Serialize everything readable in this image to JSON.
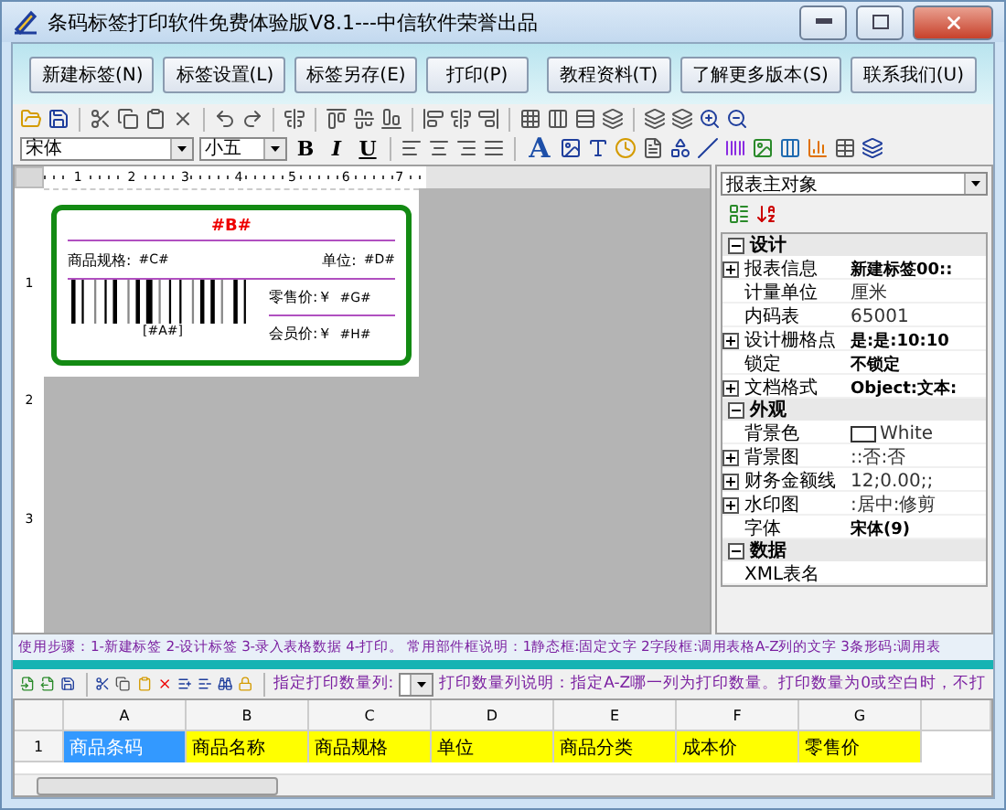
{
  "window": {
    "title": "条码标签打印软件免费体验版V8.1---中信软件荣誉出品"
  },
  "buttons_left": [
    "新建标签(N)",
    "标签设置(L)",
    "标签另存(E)",
    "打印(P)"
  ],
  "buttons_right": [
    "教程资料(T)",
    "了解更多版本(S)",
    "联系我们(U)"
  ],
  "format_bar": {
    "font": "宋体",
    "size": "小五",
    "style_buttons": [
      {
        "label": "B",
        "kind": "bold"
      },
      {
        "label": "I",
        "kind": "italic"
      },
      {
        "label": "U",
        "kind": "underline"
      }
    ],
    "text_tool": "A"
  },
  "rulers": {
    "horizontal": [
      "1",
      "2",
      "3",
      "4",
      "5",
      "6",
      "7"
    ],
    "vertical": [
      "1",
      "2",
      "3"
    ]
  },
  "label": {
    "title": "#B#",
    "spec_label": "商品规格:",
    "spec_value": "#C#",
    "unit_label": "单位:",
    "unit_value": "#D#",
    "barcode_text": "[#A#]",
    "retail_label": "零售价:￥",
    "retail_value": "#G#",
    "member_label": "会员价:￥",
    "member_value": "#H#"
  },
  "properties": {
    "object": "报表主对象",
    "sections": [
      {
        "title": "设计",
        "expanded": true,
        "rows": [
          {
            "name": "报表信息",
            "value": "新建标签00::",
            "expandable": true,
            "bold": true
          },
          {
            "name": "计量单位",
            "value": "厘米",
            "expandable": false,
            "bold": false
          },
          {
            "name": "内码表",
            "value": "65001",
            "expandable": false,
            "bold": false
          },
          {
            "name": "设计栅格点",
            "value": "是:是:10:10",
            "expandable": true,
            "bold": true
          },
          {
            "name": "锁定",
            "value": "不锁定",
            "expandable": false,
            "bold": true
          },
          {
            "name": "文档格式",
            "value": "Object:文本:",
            "expandable": true,
            "bold": true
          }
        ]
      },
      {
        "title": "外观",
        "expanded": true,
        "rows": [
          {
            "name": "背景色",
            "value": "White",
            "expandable": false,
            "bold": false,
            "color": "#ffffff"
          },
          {
            "name": "背景图",
            "value": "::否:否",
            "expandable": true,
            "bold": false
          },
          {
            "name": "财务金额线",
            "value": "12;0.00;;",
            "expandable": true,
            "bold": false
          },
          {
            "name": "水印图",
            "value": ":居中:修剪",
            "expandable": true,
            "bold": false
          },
          {
            "name": "字体",
            "value": "宋体(9)",
            "expandable": false,
            "bold": true
          }
        ]
      },
      {
        "title": "数据",
        "expanded": true,
        "rows": [
          {
            "name": "XML表名",
            "expandable": false
          }
        ]
      }
    ]
  },
  "steps": "使用步骤：1-新建标签 2-设计标签 3-录入表格数据 4-打印。 常用部件框说明：1静态框:固定文字 2字段框:调用表格A-Z列的文字 3条形码:调用表",
  "grid_toolbar": {
    "count_label": "指定打印数量列:",
    "note": "打印数量列说明：指定A-Z哪一列为打印数量。打印数量为0或空白时，不打"
  },
  "sheet": {
    "columns": [
      "A",
      "B",
      "C",
      "D",
      "E",
      "F",
      "G"
    ],
    "rows": [
      {
        "number": "1",
        "cells": [
          {
            "text": "商品条码",
            "selected": true
          },
          {
            "text": "商品名称",
            "selected": false
          },
          {
            "text": "商品规格",
            "selected": false
          },
          {
            "text": "单位",
            "selected": false
          },
          {
            "text": "商品分类",
            "selected": false
          },
          {
            "text": "成本价",
            "selected": false
          },
          {
            "text": "零售价",
            "selected": false
          }
        ]
      }
    ]
  }
}
